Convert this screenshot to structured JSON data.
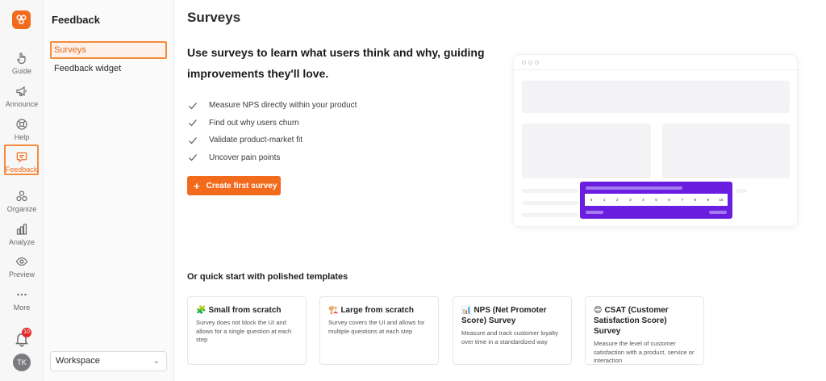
{
  "rail": {
    "items": [
      {
        "label": "Guide",
        "icon": "hand-pointer-icon"
      },
      {
        "label": "Announce",
        "icon": "megaphone-icon"
      },
      {
        "label": "Help",
        "icon": "lifebuoy-icon"
      },
      {
        "label": "Feedback",
        "icon": "feedback-icon",
        "active": true
      },
      {
        "label": "Organize",
        "icon": "organize-icon"
      },
      {
        "label": "Analyze",
        "icon": "bar-chart-icon"
      },
      {
        "label": "Preview",
        "icon": "eye-icon"
      },
      {
        "label": "More",
        "icon": "more-dots-icon"
      }
    ],
    "notification_count": "10",
    "avatar_initials": "TK"
  },
  "sidebar": {
    "title": "Feedback",
    "items": [
      {
        "label": "Surveys",
        "active": true
      },
      {
        "label": "Feedback widget"
      }
    ],
    "workspace_label": "Workspace"
  },
  "main": {
    "page_title": "Surveys",
    "hero_heading": "Use surveys to learn what users think and why, guiding improvements they'll love.",
    "benefits": [
      "Measure NPS directly within your product",
      "Find out why users churn",
      "Validate product-market fit",
      "Uncover pain points"
    ],
    "cta_label": "Create first survey",
    "nps_scale": [
      "0",
      "1",
      "2",
      "3",
      "4",
      "5",
      "6",
      "7",
      "8",
      "9",
      "10"
    ],
    "templates_heading": "Or quick start with polished templates",
    "templates": [
      {
        "emoji": "🧩",
        "title": "Small from scratch",
        "desc": "Survey does not block the UI and allows for a single question at each step"
      },
      {
        "emoji": "🏗️",
        "title": "Large from scratch",
        "desc": "Survey covers the UI and allows for multiple questions at each step"
      },
      {
        "emoji": "📊",
        "title": "NPS (Net Promoter Score) Survey",
        "desc": "Measure and track customer loyalty over time in a standardized way"
      },
      {
        "emoji": "😊",
        "title": "CSAT (Customer Satisfaction Score) Survey",
        "desc": "Measure the level of customer satisfaction with a product, service or interaction"
      }
    ]
  },
  "colors": {
    "accent": "#f26b1d",
    "nps_purple": "#6a1ee0"
  }
}
